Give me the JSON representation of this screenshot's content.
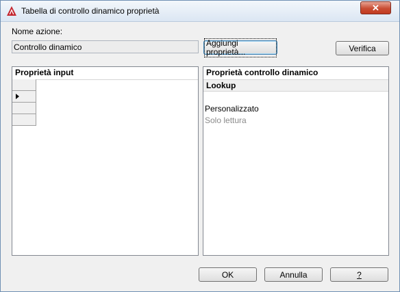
{
  "window": {
    "title": "Tabella di controllo dinamico proprietà",
    "close_label": "✕"
  },
  "form": {
    "action_name_label": "Nome azione:",
    "action_name_value": "Controllo dinamico",
    "add_properties_button": "Aggiungi proprietà...",
    "verify_button": "Verifica"
  },
  "input_panel": {
    "header": "Proprietà input"
  },
  "control_panel": {
    "header": "Proprietà controllo dinamico",
    "lookup_header": "Lookup",
    "rows": [
      "",
      "Personalizzato",
      "Solo lettura"
    ]
  },
  "footer": {
    "ok_button": "OK",
    "cancel_button": "Annulla",
    "help_button": "?"
  }
}
